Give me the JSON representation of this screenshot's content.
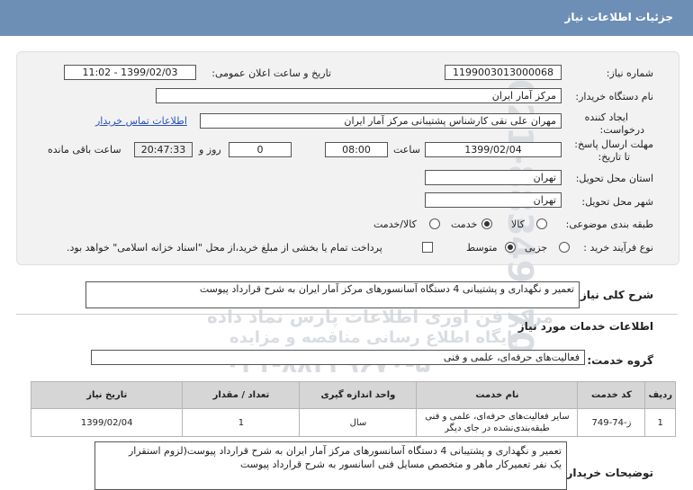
{
  "header": {
    "title": "جزئیات اطلاعات نیاز"
  },
  "form": {
    "need_number": {
      "label": "شماره نیاز:",
      "value": "1199003013000068"
    },
    "announce_datetime": {
      "label": "تاریخ و ساعت اعلان عمومی:",
      "value": "1399/02/03 - 11:02"
    },
    "buyer_org": {
      "label": "نام دستگاه خریدار:",
      "value": "مرکز آمار ایران"
    },
    "requester": {
      "label_line1": "ایجاد کننده",
      "label_line2": "درخواست:",
      "value": "مهران  علی نقی کارشناس پشتیبانی مرکز آمار ایران",
      "contact_link": "اطلاعات تماس خریدار"
    },
    "deadline": {
      "label_line1": "مهلت ارسال پاسخ:",
      "label_line2": "تا تاریخ:",
      "date": "1399/02/04",
      "time_label": "ساعت",
      "time": "08:00",
      "days": "0",
      "days_label": "روز و",
      "remaining": "20:47:33",
      "remaining_label": "ساعت باقی مانده"
    },
    "province": {
      "label": "استان محل تحویل:",
      "value": "تهران"
    },
    "city": {
      "label": "شهر محل تحویل:",
      "value": "تهران"
    },
    "category": {
      "label": "طبقه بندی موضوعی:",
      "options": [
        "کالا",
        "خدمت",
        "کالا/خدمت"
      ],
      "selected": "خدمت"
    },
    "purchase_type": {
      "label": "نوع فرآیند خرید :",
      "options": [
        "جزیی",
        "متوسط"
      ],
      "selected": "متوسط",
      "payment_note": "پرداخت تمام یا بخشی از مبلغ خرید،از محل \"اسناد خزانه اسلامی\" خواهد بود."
    }
  },
  "summary": {
    "label": "شرح کلی نیاز:",
    "value": "تعمیر و نگهداری و پشتیبانی 4 دستگاه آسانسورهای مرکز آمار ایران به شرح قرارداد پیوست"
  },
  "services_heading": "اطلاعات خدمات مورد نیاز",
  "service_group": {
    "label": "گروه خدمت:",
    "value": "فعالیت‌های حرفه‌ای، علمی و فنی"
  },
  "table": {
    "headers": [
      "ردیف",
      "کد خدمت",
      "نام خدمت",
      "واحد اندازه گیری",
      "تعداد / مقدار",
      "تاریخ نیاز"
    ],
    "rows": [
      [
        "1",
        "ز-74-749",
        "سایر فعالیت‌های حرفه‌ای، علمی و فنی طبقه‌بندی‌نشده در جای دیگر",
        "سال",
        "1",
        "1399/02/04"
      ]
    ]
  },
  "buyer_notes": {
    "label": "توضیحات خریدار:",
    "line1": "تعمیر و نگهداری و پشتیبانی 4 دستگاه آسانسورهای مرکز آمار ایران به شرح قرارداد پیوست(لزوم استقرار",
    "line2": "یک نفر تعمیرکار ماهر و متخصص مسایل فنی اسانسور به شرح قرارداد پیوست"
  },
  "watermark": {
    "number": "021-88349670",
    "brand": "ParsNamadData",
    "tagline": "مرکز فن آوری اطلاعات پارس نماد داده",
    "line2": "پایگاه اطلاع رسانی مناقصه و مزایده",
    "phone": "۰۲۱-۸۸۳۴۹۶۷۰-۵"
  }
}
